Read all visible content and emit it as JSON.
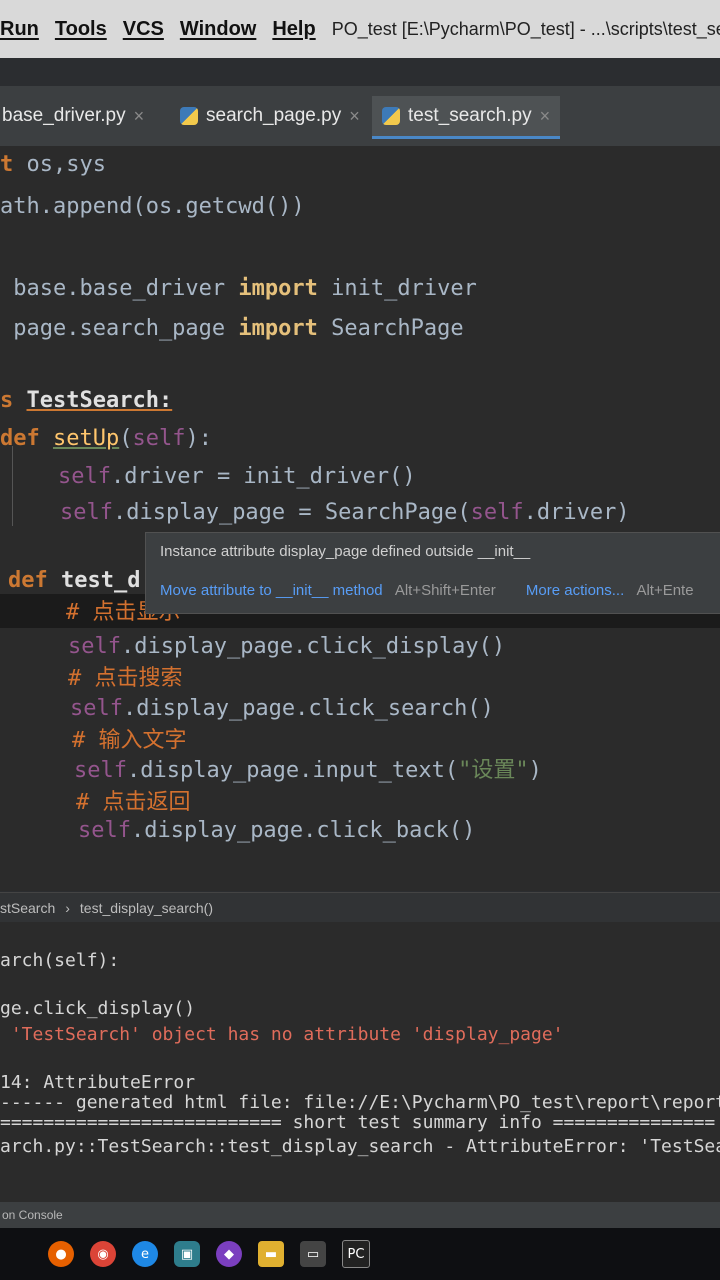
{
  "menu": {
    "items": [
      "Run",
      "Tools",
      "VCS",
      "Window",
      "Help"
    ],
    "window_title": "PO_test [E:\\Pycharm\\PO_test] - ...\\scripts\\test_se"
  },
  "tabs": [
    {
      "label": "base_driver.py",
      "active": false
    },
    {
      "label": "search_page.py",
      "active": false
    },
    {
      "label": "test_search.py",
      "active": true
    }
  ],
  "code": {
    "l1": [
      "t ",
      "os,sys"
    ],
    "l2": "ath.append(os.getcwd())",
    "l3": [
      " base.base_driver ",
      "import",
      " init_driver"
    ],
    "l4": [
      " page.search_page ",
      "import",
      " SearchPage"
    ],
    "l5": [
      "s ",
      "TestSearch:"
    ],
    "l6": [
      "def ",
      "setUp",
      "(",
      "self",
      "):"
    ],
    "l7": [
      "self",
      ".driver = init_driver()"
    ],
    "l8": [
      "self",
      ".display_page = SearchPage(",
      "self",
      ".driver)"
    ],
    "l9": [
      "def ",
      "test_d"
    ],
    "c1": "# 点击显示",
    "s1": [
      "self",
      ".display_page.click_display()"
    ],
    "c2": "# 点击搜索",
    "s2": [
      "self",
      ".display_page.click_search()"
    ],
    "c3": "# 输入文字",
    "s3": [
      "self",
      ".display_page.input_text(",
      "\"设置\"",
      ")"
    ],
    "c4": "# 点击返回",
    "s4": [
      "self",
      ".display_page.click_back()"
    ]
  },
  "popup": {
    "message": "Instance attribute display_page defined outside __init__",
    "action": "Move attribute to __init__ method",
    "action_shortcut": "Alt+Shift+Enter",
    "more": "More actions...",
    "more_shortcut": "Alt+Ente"
  },
  "breadcrumb": {
    "class": "stSearch",
    "method": "test_display_search()"
  },
  "console": {
    "lines": [
      "arch(self):",
      "ge.click_display()",
      " 'TestSearch' object has no attribute 'display_page'",
      "14: AttributeError",
      "------ generated html file: file://E:\\Pycharm\\PO_test\\report\\report.",
      "========================== short test summary info ===============",
      "arch.py::TestSearch::test_display_search - AttributeError: 'TestSearch"
    ],
    "status": "on Console"
  },
  "taskbar": {
    "icons": [
      "firefox-icon",
      "chrome-icon",
      "ie-icon",
      "vnc-icon",
      "app-icon",
      "folder-icon",
      "terminal-icon",
      "pycharm-icon"
    ]
  },
  "colors": {
    "accent": "#4a88c7",
    "error": "#e06c5b",
    "keyword": "#cc7832"
  }
}
